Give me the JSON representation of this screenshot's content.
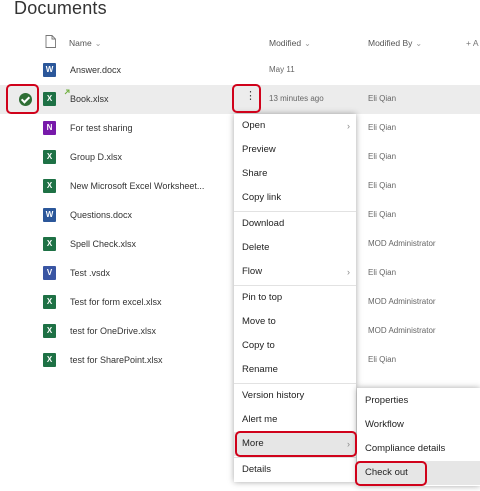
{
  "page": {
    "title": "Documents"
  },
  "columns": {
    "name": "Name",
    "modified": "Modified",
    "modified_by": "Modified By",
    "add_column": "+ A"
  },
  "files": [
    {
      "name": "Answer.docx",
      "modified": "May 11",
      "by": "",
      "type": "w",
      "glyph": "W"
    },
    {
      "name": "Book.xlsx",
      "modified": "13 minutes ago",
      "by": "Eli Qian",
      "type": "x",
      "glyph": "X"
    },
    {
      "name": "For test sharing",
      "modified": "",
      "by": "Eli Qian",
      "type": "o",
      "glyph": "N"
    },
    {
      "name": "Group D.xlsx",
      "modified": "",
      "by": "Eli Qian",
      "type": "x",
      "glyph": "X"
    },
    {
      "name": "New Microsoft Excel Worksheet...",
      "modified": "",
      "by": "Eli Qian",
      "type": "x",
      "glyph": "X"
    },
    {
      "name": "Questions.docx",
      "modified": "",
      "by": "Eli Qian",
      "type": "w",
      "glyph": "W"
    },
    {
      "name": "Spell Check.xlsx",
      "modified": "",
      "by": "MOD Administrator",
      "type": "x",
      "glyph": "X"
    },
    {
      "name": "Test .vsdx",
      "modified": "",
      "by": "Eli Qian",
      "type": "v",
      "glyph": "V"
    },
    {
      "name": "Test for form excel.xlsx",
      "modified": "",
      "by": "MOD Administrator",
      "type": "x",
      "glyph": "X"
    },
    {
      "name": "test for OneDrive.xlsx",
      "modified": "",
      "by": "MOD Administrator",
      "type": "x",
      "glyph": "X"
    },
    {
      "name": "test for SharePoint.xlsx",
      "modified": "",
      "by": "Eli Qian",
      "type": "x",
      "glyph": "X"
    }
  ],
  "context_menu": {
    "open": "Open",
    "preview": "Preview",
    "share": "Share",
    "copy_link": "Copy link",
    "download": "Download",
    "delete": "Delete",
    "flow": "Flow",
    "pin_to_top": "Pin to top",
    "move_to": "Move to",
    "copy_to": "Copy to",
    "rename": "Rename",
    "version_history": "Version history",
    "alert_me": "Alert me",
    "more": "More",
    "details": "Details"
  },
  "submenu": {
    "properties": "Properties",
    "workflow": "Workflow",
    "compliance_details": "Compliance details",
    "check_out": "Check out"
  },
  "icons": {
    "more": "ellipsis-vertical-icon",
    "submenu": "chevron-right-icon",
    "selected": "checkmark-circle-icon",
    "sort": "chevron-down-icon",
    "document_header": "document-icon"
  },
  "colors": {
    "highlight": "#d0021b",
    "excel": "#1e7145",
    "word": "#2b579a",
    "onenote": "#7719aa",
    "visio": "#3955a3",
    "selected_check": "#2f6e35"
  }
}
